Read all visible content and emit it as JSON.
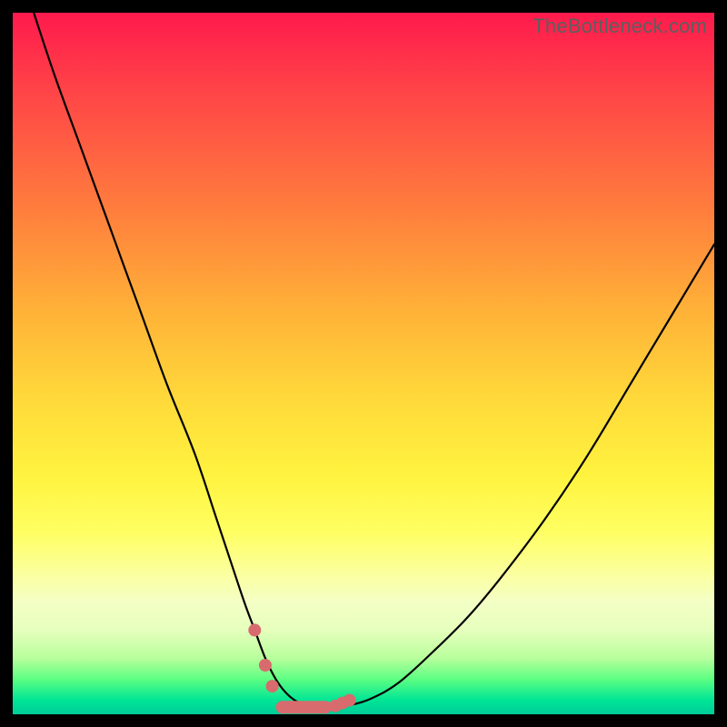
{
  "watermark": "TheBottleneck.com",
  "colors": {
    "background_frame": "#000000",
    "curve_stroke": "#000000",
    "marker_fill": "#d86b6d",
    "gradient_top": "#ff1a4d",
    "gradient_bottom": "#00cc99"
  },
  "chart_data": {
    "type": "line",
    "title": "",
    "xlabel": "",
    "ylabel": "",
    "xlim": [
      0,
      100
    ],
    "ylim": [
      0,
      100
    ],
    "grid": false,
    "legend": false,
    "series": [
      {
        "name": "curve",
        "x": [
          3,
          6,
          10,
          14,
          18,
          22,
          26,
          29,
          31,
          33,
          34.5,
          36,
          37.5,
          39,
          40.5,
          42,
          44,
          46,
          48,
          51,
          55,
          60,
          65,
          70,
          76,
          82,
          88,
          94,
          100
        ],
        "y": [
          100,
          91,
          80,
          69,
          58,
          47,
          37,
          28,
          22,
          16,
          12,
          8,
          5,
          3,
          1.8,
          1.2,
          1.0,
          1.0,
          1.3,
          2.2,
          4.5,
          9,
          14,
          20,
          28,
          37,
          47,
          57,
          67
        ]
      }
    ],
    "markers": {
      "name": "bottom-cluster",
      "points": [
        {
          "x": 34.5,
          "y": 12
        },
        {
          "x": 36.0,
          "y": 7
        },
        {
          "x": 37.0,
          "y": 4
        },
        {
          "x": 46.0,
          "y": 1.2
        },
        {
          "x": 47.0,
          "y": 1.6
        },
        {
          "x": 48.0,
          "y": 2.0
        }
      ],
      "bar": {
        "x0": 37.5,
        "x1": 45.5,
        "y": 1.0
      }
    }
  }
}
